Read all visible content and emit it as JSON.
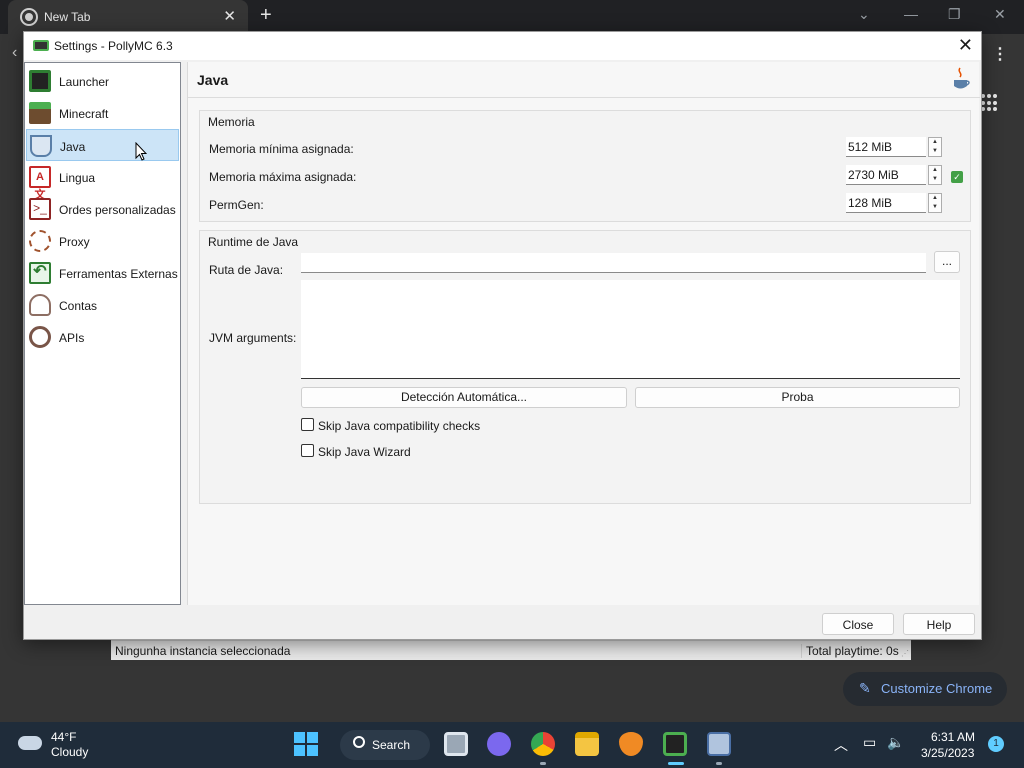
{
  "browser": {
    "tab_title": "New Tab",
    "customize_label": "Customize Chrome"
  },
  "main_window": {
    "status_left": "Ningunha instancia seleccionada",
    "status_right": "Total playtime: 0s"
  },
  "dialog": {
    "title": "Settings - PollyMC 6.3",
    "close_label": "Close",
    "help_label": "Help"
  },
  "sidebar": {
    "items": [
      {
        "label": "Launcher",
        "icon": "launcher-icon",
        "color": "#2e7d32"
      },
      {
        "label": "Minecraft",
        "icon": "grass-block-icon",
        "color": "#6d4c2f"
      },
      {
        "label": "Java",
        "icon": "java-icon",
        "color": "#5a7fa8"
      },
      {
        "label": "Lingua",
        "icon": "language-icon",
        "color": "#c62828"
      },
      {
        "label": "Ordes personalizadas",
        "icon": "terminal-icon",
        "color": "#8e2424"
      },
      {
        "label": "Proxy",
        "icon": "proxy-icon",
        "color": "#a0522d"
      },
      {
        "label": "Ferramentas Externas",
        "icon": "external-tools-icon",
        "color": "#2e7d32"
      },
      {
        "label": "Contas",
        "icon": "accounts-icon",
        "color": "#8d6e63"
      },
      {
        "label": "APIs",
        "icon": "api-icon",
        "color": "#795548"
      }
    ],
    "selected_index": 2
  },
  "java_page": {
    "title": "Java",
    "memory": {
      "group_title": "Memoria",
      "min_label": "Memoria mínima asignada:",
      "min_value": "512 MiB",
      "max_label": "Memoria máxima asignada:",
      "max_value": "2730 MiB",
      "permgen_label": "PermGen:",
      "permgen_value": "128 MiB"
    },
    "runtime": {
      "group_title": "Runtime de Java",
      "path_label": "Ruta de Java:",
      "path_value": "",
      "browse_label": "...",
      "jvm_label": "JVM arguments:",
      "jvm_value": "",
      "autodetect_label": "Detección Automática...",
      "test_label": "Proba",
      "skip_compat_label": "Skip Java compatibility checks",
      "skip_compat_checked": false,
      "skip_wizard_label": "Skip Java Wizard",
      "skip_wizard_checked": false
    }
  },
  "taskbar": {
    "temperature": "44°F",
    "condition": "Cloudy",
    "search_label": "Search",
    "time": "6:31 AM",
    "date": "3/25/2023",
    "notification_count": "1"
  }
}
